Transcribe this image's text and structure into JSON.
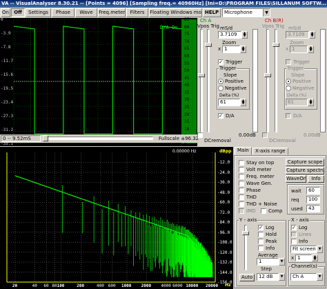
{
  "window": {
    "title": "VA -- VisualAnalyser 8.30.21 -- [Points = 4096] [Sampling freq.= 40960Hz] [Ini=D:\\PROGRAM FILES\\SILLANUM SOFTW..."
  },
  "toolbar": {
    "on_label": "On",
    "off_label": "Off",
    "settings_label": "Settings",
    "phase_label": "Phase",
    "wave_label": "Wave",
    "freqmeter_label": "Freq.meter",
    "filters_label": "Filters",
    "floating_label": "Floating Windows mode",
    "help_label": "HELP",
    "input_value": "Microphone"
  },
  "scope": {
    "da_label": "D/A On",
    "left_ticks": [
      "0",
      "-3.9",
      "-7.8",
      "-11.7",
      "-15.6",
      "-19.5",
      "-23.4",
      "-27.3",
      "-31.2",
      "-35.1"
    ],
    "right_ticks": [
      "85",
      "80",
      "75",
      "70",
      "65",
      "60",
      "55",
      "50",
      "45",
      "40",
      "35",
      "30",
      "25",
      "20",
      "15",
      "10",
      "5",
      "0"
    ],
    "time_readout": "0 -- 9.52mS",
    "fullscale_readout": "Fullscale ±96.32",
    "waveform_color": "#00ff00",
    "grid_color": "#008000"
  },
  "trig_panel": {
    "ch_a_label": "Ch A",
    "vpos_label": "Vpos Trig",
    "ms_div_label": "mS/d",
    "ms_div_value": "3.7109",
    "zoom_label": "Zoom",
    "zoom_value": "1",
    "trigger_check_label": "Trigger",
    "trigger_group_label": "Trigger",
    "slope_label": "Slope",
    "positive_label": "Positive",
    "negative_label": "Negative",
    "delta_label": "Delta (%)",
    "delta_value": "61",
    "da_check_label": "D/A",
    "dcremoval_label": "DCremoval",
    "db_readout": "0.00dB"
  },
  "chb_panel": {
    "ch_b_label": "Ch B(R)",
    "vpos_label": "Vpos Trig",
    "ms_div_label": "mS/d",
    "ms_div_value": "3.7109",
    "zoom_label": "Zoom",
    "zoom_value": "1",
    "trigger_check_label": "Trigger",
    "trigger_group_label": "Trigger",
    "slope_label": "Slope",
    "positive_label": "Positive",
    "negative_label": "Negative",
    "delta_label": "Delta (%)",
    "delta_value": "61",
    "da_check_label": "D/A",
    "dcremoval_label": "DCremoval",
    "db_readout": "0.00dB"
  },
  "spectrum": {
    "freq_readout": "0.00000 Hz",
    "db_unit": "dBpp",
    "y_ticks": [
      "-12.0",
      "-24.0",
      "-36.0",
      "-48.0",
      "-60.0",
      "-72.0",
      "-84.0",
      "-96.0",
      "-108.0",
      "-120.0",
      "-132.0",
      "-144.0",
      "-156.0"
    ],
    "x_ticks": [
      "20",
      "40",
      "60",
      "80",
      "100",
      "200",
      "400",
      "600",
      "1000",
      "2000",
      "4000",
      "6000",
      "10000",
      "20000"
    ],
    "x_unit": "Hz",
    "trace_color": "#00ff00"
  },
  "main_panel": {
    "tabs": [
      "Main",
      "X-axis range"
    ],
    "stay_on_top": "Stay on top",
    "volt_meter": "Volt meter",
    "freq_meter": "Freq. meter",
    "wave_gen": "Wave Gen.",
    "phase": "Phase",
    "thd": "THD",
    "thd_noise": "THD + Noise",
    "imd": "IMD",
    "comp": "Comp",
    "capture_scope": "Capture scope",
    "capture_spectrum": "Capture spectrum",
    "waveon": "WaveOn",
    "info": "Info",
    "wait_label": "wait",
    "wait_value": "60",
    "req_label": "req",
    "req_value": "100",
    "used_label": "used",
    "used_value": "43",
    "y_axis_label": "Y - axis",
    "log_label": "Log",
    "hold_label": "Hold",
    "peak_label": "Peak",
    "info_label": "Info",
    "average_label": "Average",
    "average_value": "1",
    "step_label": "Step",
    "step_value": "12 dB",
    "auto_label": "Auto",
    "x_axis_label": "X - axis",
    "x_log_label": "Log",
    "x_lines_label": "Lines",
    "x_info_label": "Info",
    "fit_value": "Fit screen",
    "zoom_value": "1",
    "channels_label": "Channel(s)",
    "channels_value": "Ch A"
  }
}
